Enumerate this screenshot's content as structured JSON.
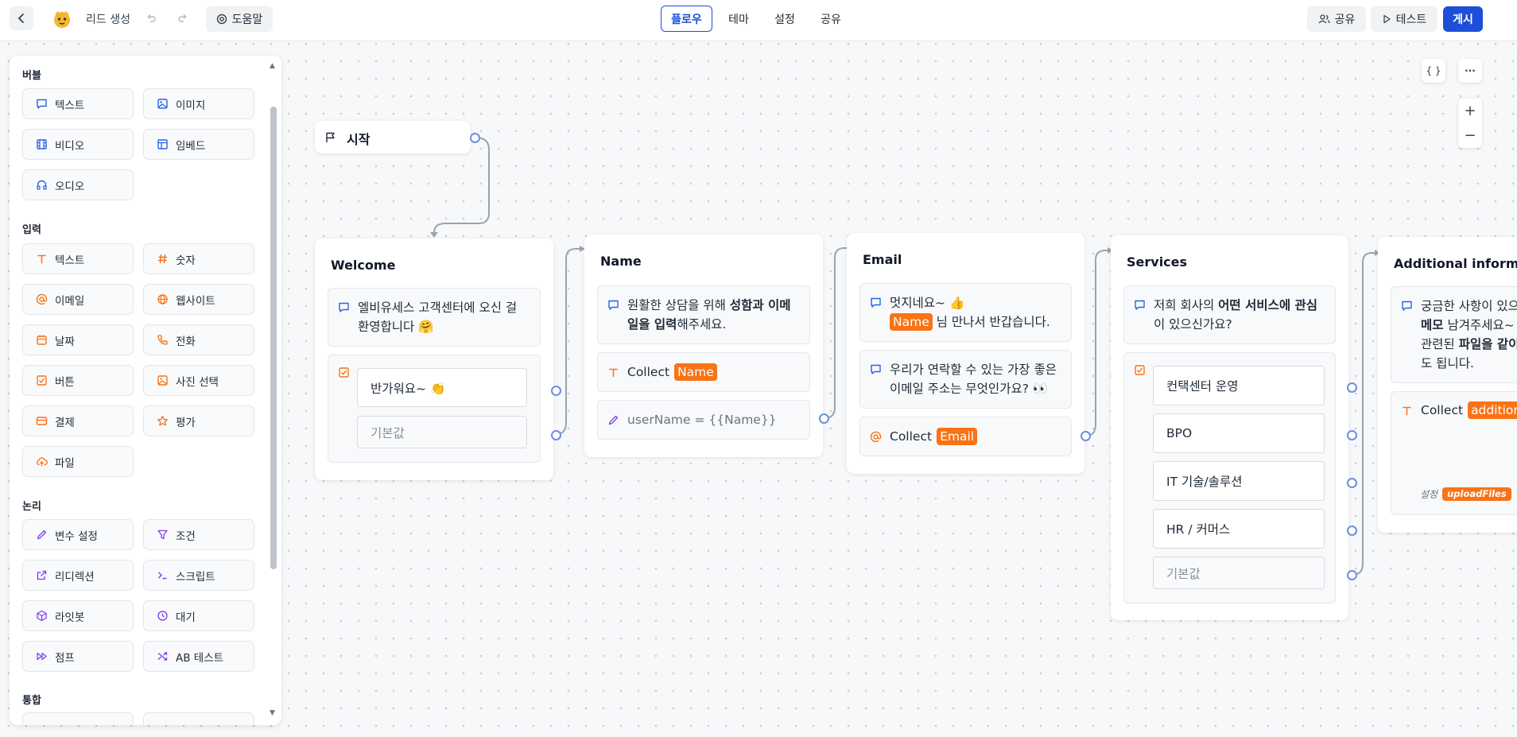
{
  "topbar": {
    "title": "리드 생성",
    "help_label": "도움말",
    "tabs": [
      "플로우",
      "테마",
      "설정",
      "공유"
    ],
    "share_label": "공유",
    "test_label": "테스트",
    "publish_label": "게시"
  },
  "sidebar": {
    "sections": {
      "bubble": "버블",
      "input": "입력",
      "logic": "논리",
      "integration": "통합"
    },
    "bubble_blocks": [
      "텍스트",
      "이미지",
      "비디오",
      "임베드",
      "오디오"
    ],
    "input_blocks": [
      "텍스트",
      "숫자",
      "이메일",
      "웹사이트",
      "날짜",
      "전화",
      "버튼",
      "사진 선택",
      "결제",
      "평가",
      "파일"
    ],
    "logic_blocks": [
      "변수 설정",
      "조건",
      "리디렉션",
      "스크립트",
      "라잇봇",
      "대기",
      "점프",
      "AB 테스트"
    ]
  },
  "canvas": {
    "code_label": "{ }",
    "more_label": "···",
    "zoom_in": "+",
    "zoom_out": "−",
    "start": {
      "title": "시작"
    },
    "welcome": {
      "title": "Welcome",
      "bubble_line1": "엘비유세스 고객센터에 오신 걸",
      "bubble_line2": "환영합니다 🤗",
      "button_choice": "반가워요~ 👏",
      "default_placeholder": "기본값"
    },
    "name": {
      "title": "Name",
      "bubble_pre": "원활한 상담을 위해 ",
      "bubble_bold": "성함과 이메일을 입력",
      "bubble_post": "해주세요.",
      "collect_label": "Collect",
      "collect_var": "Name",
      "set_var": "userName = {{Name}}"
    },
    "email": {
      "title": "Email",
      "bubble1_line1": "멋지네요~ 👍",
      "bubble1_var": "Name",
      "bubble1_after": " 님 만나서 반갑습니다.",
      "bubble2": "우리가 연락할 수 있는 가장 좋은 이메일 주소는 무엇인가요? 👀",
      "collect_label": "Collect",
      "collect_var": "Email"
    },
    "services": {
      "title": "Services",
      "bubble_pre": "저희 회사의 ",
      "bubble_bold": "어떤 서비스에 관심",
      "bubble_post": "이 있으신가요?",
      "choices": [
        "컨택센터 운영",
        "BPO",
        "IT 기술/솔루션",
        "HR / 커머스"
      ],
      "default_placeholder": "기본값"
    },
    "additional": {
      "title": "Additional informat",
      "bubble_line1": "궁금한 사항이 있으",
      "bubble_line2_bold": "메모",
      "bubble_line2_rest": " 남겨주세요~",
      "bubble_line3_pre": "관련된 ",
      "bubble_line3_bold": "파일을 같이",
      "bubble_line4": "도 됩니다.",
      "collect_label": "Collect",
      "collect_var": "addition",
      "settings_label": "설정",
      "settings_var": "uploadFiles"
    }
  },
  "colors": {
    "accent": "#1d4ed8",
    "variable": "#f97316",
    "port": "#6b8fe8"
  }
}
